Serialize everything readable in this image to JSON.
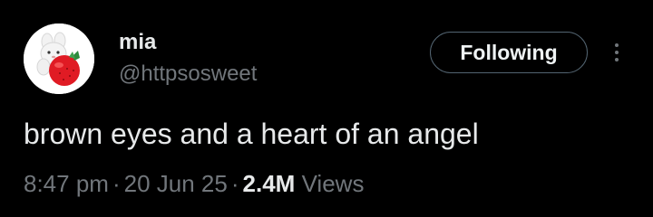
{
  "colors": {
    "background": "#000000",
    "primary_text": "#e7e9ea",
    "secondary_text": "#71767b",
    "button_border": "#536471"
  },
  "author": {
    "display_name": "mia",
    "handle": "@httpsosweet",
    "avatar_icon": "plush-bunny-with-strawberry-avatar"
  },
  "actions": {
    "follow_label": "Following",
    "more_icon": "vertical-ellipsis-icon"
  },
  "tweet": {
    "text": "brown eyes and a heart of an angel"
  },
  "meta": {
    "time": "8:47 pm",
    "separator": "·",
    "date": "20 Jun 25",
    "views_count": "2.4M",
    "views_label": "Views"
  }
}
